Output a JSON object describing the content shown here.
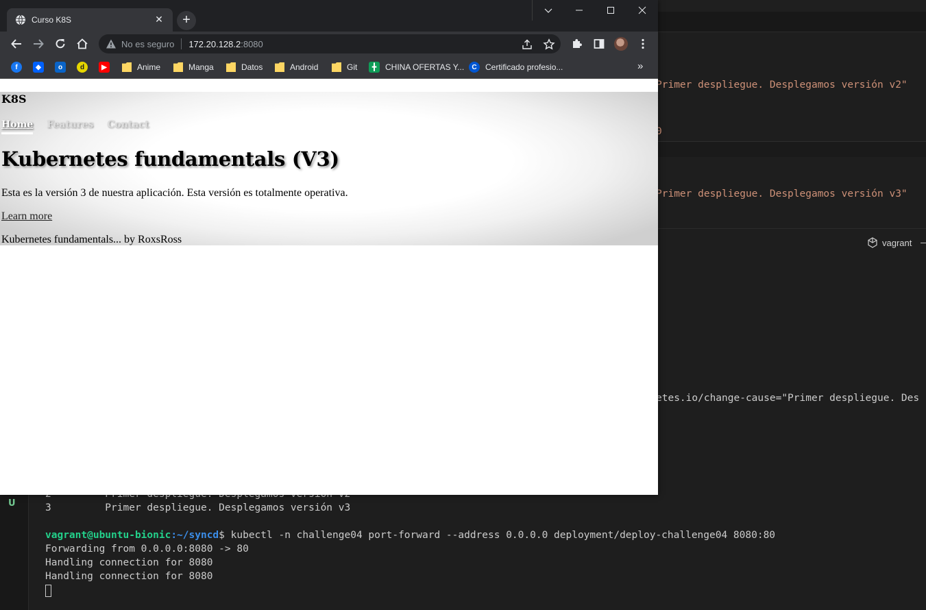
{
  "browser": {
    "tab_title": "Curso K8S",
    "tab_close": "✕",
    "new_tab": "+",
    "address_warning": "No es seguro",
    "address_host": "172.20.128.2",
    "address_port": ":8080",
    "bookmarks": [
      {
        "label": "Anime"
      },
      {
        "label": "Manga"
      },
      {
        "label": "Datos"
      },
      {
        "label": "Android"
      },
      {
        "label": "Git"
      },
      {
        "label": "CHINA OFERTAS Y..."
      },
      {
        "label": "Certificado profesio..."
      }
    ],
    "bookmarks_more": "»"
  },
  "site": {
    "brand": "K8S",
    "nav": [
      "Home",
      "Features",
      "Contact"
    ],
    "heading": "Kubernetes fundamentals (V3)",
    "lead": "Esta es la versión 3 de nuestra aplicación. Esta versión es totalmente operativa.",
    "learn_more": "Learn more",
    "footer": "Kubernetes fundamentals... by RoxsRoss"
  },
  "editor": {
    "line_v2": "Primer despliegue. Desplegamos versión v2\"",
    "line_zero": "0",
    "line_v3": "Primer despliegue. Desplegamos versión v3\"",
    "change_cause": "etes.io/change-cause=\"Primer despliegue. Des",
    "terminal_profile": "vagrant",
    "scm_marker": "U"
  },
  "terminal": {
    "history_2": "2         Primer despliegue. Desplegamos versión v2",
    "history_3": "3         Primer despliegue. Desplegamos versión v3",
    "prompt_user": "vagrant@ubuntu-bionic",
    "prompt_path": ":~/syncd",
    "command": "$ kubectl -n challenge04 port-forward --address 0.0.0.0 deployment/deploy-challenge04 8080:80",
    "out_1": "Forwarding from 0.0.0.0:8080 -> 80",
    "out_2": "Handling connection for 8080",
    "out_3": "Handling connection for 8080"
  }
}
